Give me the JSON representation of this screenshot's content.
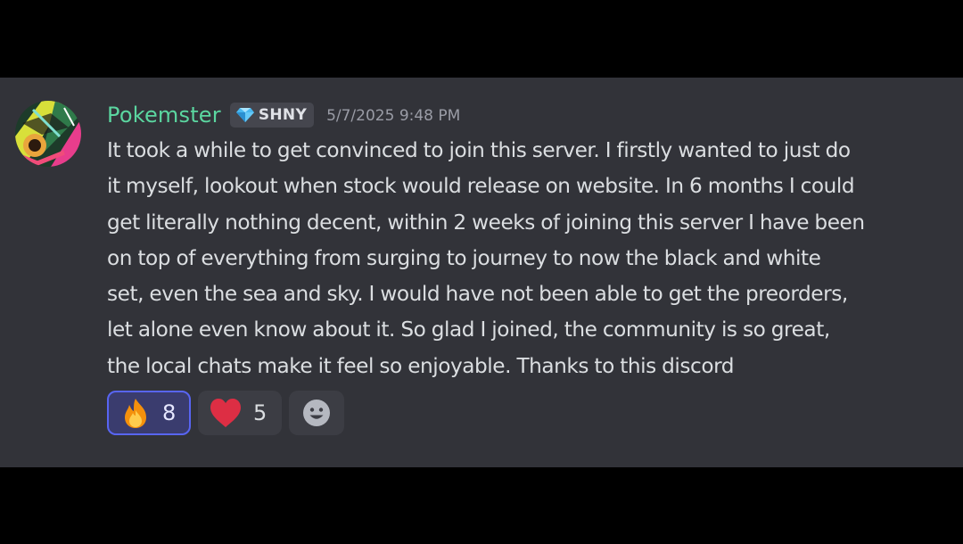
{
  "message": {
    "author": "Pokemster",
    "author_color": "#5bd6a0",
    "guild_tag": {
      "icon": "diamond-icon",
      "label": "SHNY"
    },
    "timestamp": "5/7/2025 9:48 PM",
    "lines": [
      "It took a while to get convinced to join this server. I firstly wanted to just do",
      "it myself, lookout when stock would release on website. In 6 months I could",
      "get literally nothing decent, within 2 weeks of joining this server I have been",
      "on top of everything from surging to journey to now the black and white",
      "set, even the sea and sky. I would have not been able to get the preorders,",
      "let alone even know about it. So glad I joined, the community is so great,",
      "the local chats make it feel so enjoyable. Thanks to this discord"
    ]
  },
  "reactions": [
    {
      "emoji": "fire-emoji",
      "count": "8",
      "active": true
    },
    {
      "emoji": "red-heart-emoji",
      "count": "5",
      "active": false
    }
  ],
  "add_reaction": {
    "icon": "smiley-icon"
  },
  "colors": {
    "background": "#323339",
    "letterbox": "#000000",
    "text": "#dbdee1",
    "timestamp": "#9a9ca6",
    "active_reaction_border": "#5865f2"
  }
}
